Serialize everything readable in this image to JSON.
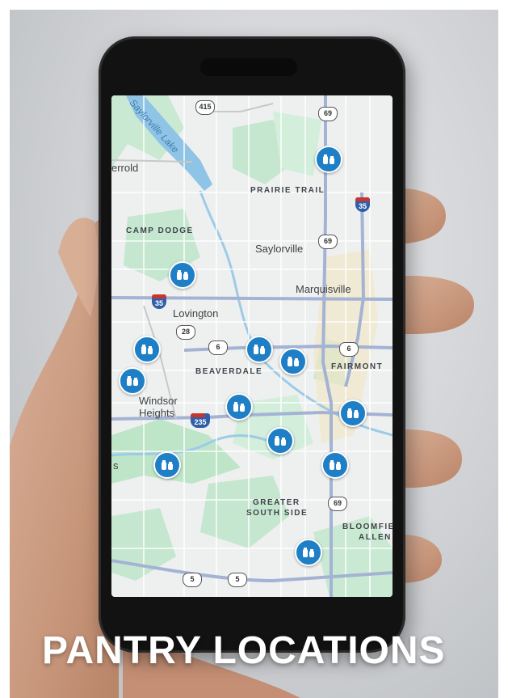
{
  "title": "PANTRY LOCATIONS",
  "colors": {
    "pin": "#1e7fc7",
    "park": "#bfe5c9",
    "water": "#9ccbe8",
    "road": "#8fa3c8"
  },
  "map": {
    "labels": [
      {
        "id": "saylorville-lake",
        "text": "Saylorville Lake"
      },
      {
        "id": "errold",
        "text": "errold"
      },
      {
        "id": "prairie-trail",
        "text": "PRAIRIE TRAIL"
      },
      {
        "id": "camp-dodge",
        "text": "CAMP DODGE"
      },
      {
        "id": "saylorville",
        "text": "Saylorville"
      },
      {
        "id": "marquisville",
        "text": "Marquisville"
      },
      {
        "id": "lovington",
        "text": "Lovington"
      },
      {
        "id": "beaverdale",
        "text": "BEAVERDALE"
      },
      {
        "id": "fairmont",
        "text": "FAIRMONT"
      },
      {
        "id": "windsor",
        "text": "Windsor"
      },
      {
        "id": "heights",
        "text": "Heights"
      },
      {
        "id": "greater",
        "text": "GREATER"
      },
      {
        "id": "south-side",
        "text": "SOUTH SIDE"
      },
      {
        "id": "bloomfie",
        "text": "BLOOMFIE"
      },
      {
        "id": "allen",
        "text": "ALLEN"
      },
      {
        "id": "s-edge",
        "text": "s"
      }
    ],
    "shields": [
      {
        "id": "r415",
        "text": "415"
      },
      {
        "id": "r69a",
        "text": "69"
      },
      {
        "id": "r69b",
        "text": "69"
      },
      {
        "id": "r28",
        "text": "28"
      },
      {
        "id": "r6a",
        "text": "6"
      },
      {
        "id": "r6b",
        "text": "6"
      },
      {
        "id": "r69c",
        "text": "69"
      },
      {
        "id": "r5a",
        "text": "5"
      },
      {
        "id": "r5b",
        "text": "5"
      }
    ],
    "interstates": [
      {
        "id": "i35a",
        "text": "35"
      },
      {
        "id": "i35b",
        "text": "35"
      },
      {
        "id": "i235",
        "text": "235"
      }
    ],
    "pins": 13
  }
}
